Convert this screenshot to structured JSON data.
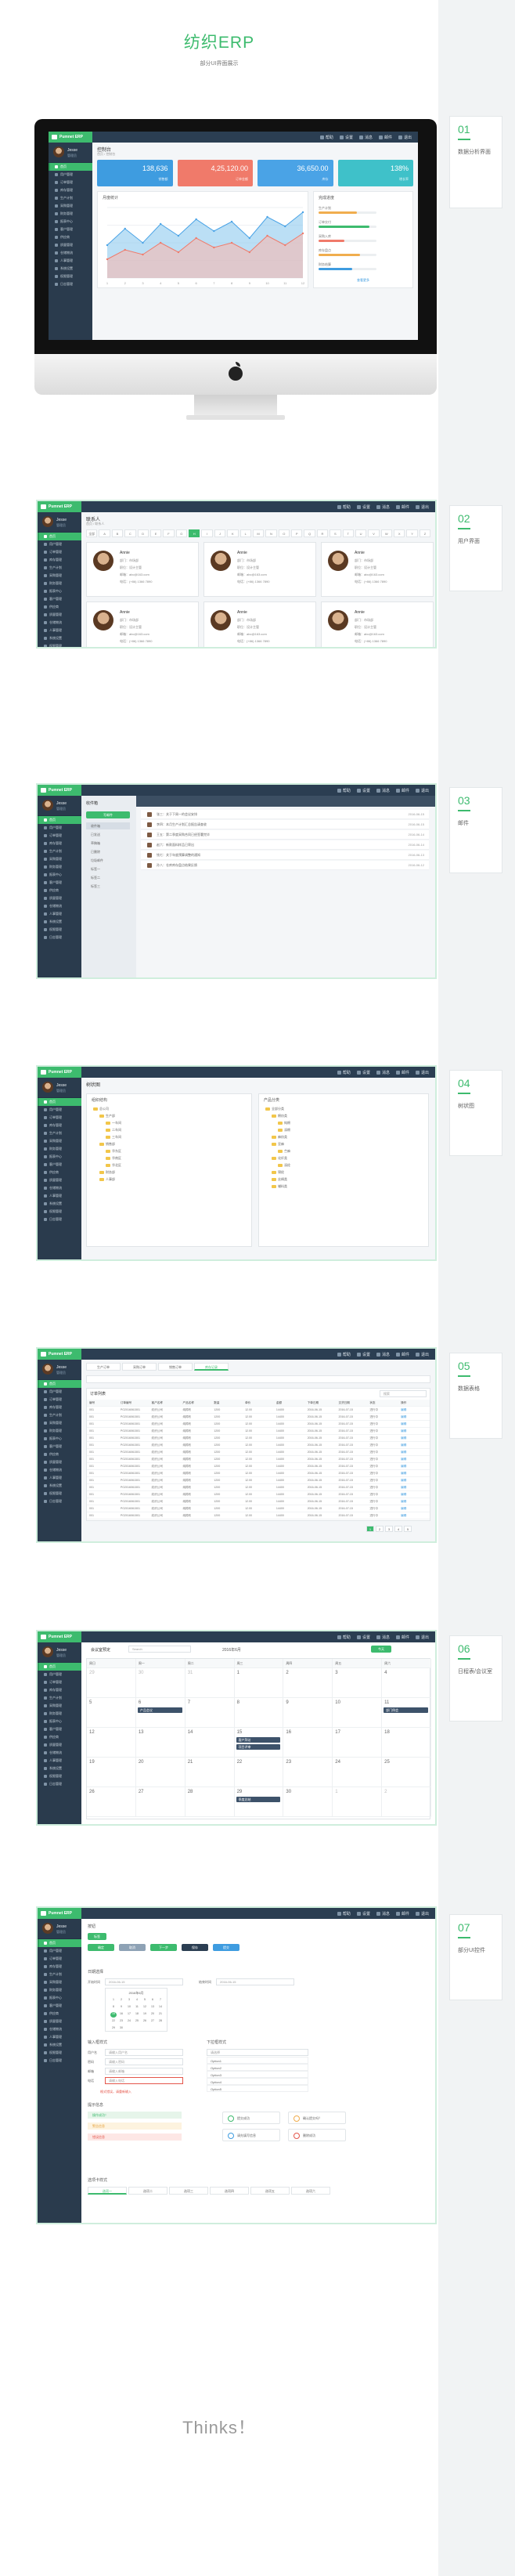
{
  "hero": {
    "title": "纺织ERP",
    "subtitle": "部分UI界面展示"
  },
  "footer": {
    "thanks": "Thinks！"
  },
  "sections": [
    {
      "num": "01",
      "label": "数据分析界面"
    },
    {
      "num": "02",
      "label": "用户界面"
    },
    {
      "num": "03",
      "label": "邮件"
    },
    {
      "num": "04",
      "label": "树状图"
    },
    {
      "num": "05",
      "label": "数据表格"
    },
    {
      "num": "06",
      "label": "日程表/会议室"
    },
    {
      "num": "07",
      "label": "部分UI控件"
    }
  ],
  "app": {
    "logo": "Pumnet ERP",
    "profile": {
      "name": "Jesse",
      "role": "管理员"
    },
    "topbar": [
      "帮助",
      "设置",
      "消息",
      "邮件",
      "退出"
    ],
    "nav": [
      "首页",
      "用户管理",
      "订单管理",
      "库存管理",
      "生产计划",
      "采购管理",
      "财务管理",
      "报表中心",
      "客户管理",
      "供应商",
      "质量管理",
      "仓储物流",
      "人事管理",
      "系统设置",
      "权限管理",
      "日志管理"
    ]
  },
  "dashboard": {
    "page_title": "控制台",
    "breadcrumb": "首页 / 控制台",
    "kpis": [
      {
        "value": "138,636",
        "label": "销售额",
        "color": "#3e9ce0"
      },
      {
        "value": "4,25,120.00",
        "label": "订单金额",
        "color": "#f07a6a"
      },
      {
        "value": "36,650.00",
        "label": "库存",
        "color": "#4aa3e6"
      },
      {
        "value": "138%",
        "label": "增长率",
        "color": "#3fc1c9"
      }
    ],
    "chart_title": "月度统计",
    "progress_title": "完成进度",
    "progress": [
      {
        "label": "生产计划",
        "value": 0.66,
        "color": "#f0ad4e"
      },
      {
        "label": "订单交付",
        "value": 0.88,
        "color": "#3dbb6e"
      },
      {
        "label": "采购入库",
        "value": 0.45,
        "color": "#f07a6a"
      },
      {
        "label": "库存盘点",
        "value": 0.72,
        "color": "#f0ad4e"
      },
      {
        "label": "财务结算",
        "value": 0.58,
        "color": "#3e9ce0"
      }
    ],
    "more": "查看更多"
  },
  "chart_data": {
    "type": "area",
    "x": [
      "1",
      "2",
      "3",
      "4",
      "5",
      "6",
      "7",
      "8",
      "9",
      "10",
      "11",
      "12"
    ],
    "series": [
      {
        "values": [
          28,
          42,
          30,
          46,
          36,
          50,
          40,
          48,
          34,
          52,
          44,
          56
        ]
      },
      {
        "values": [
          16,
          24,
          20,
          30,
          22,
          34,
          26,
          30,
          22,
          36,
          28,
          38
        ]
      }
    ],
    "ylim": [
      0,
      60
    ]
  },
  "contacts": {
    "page_title": "联系人",
    "breadcrumb": "首页 / 联系人",
    "letters": [
      "全部",
      "A",
      "B",
      "C",
      "D",
      "E",
      "F",
      "G",
      "H",
      "I",
      "J",
      "K",
      "L",
      "M",
      "N",
      "O",
      "P",
      "Q",
      "R",
      "S",
      "T",
      "U",
      "V",
      "W",
      "X",
      "Y",
      "Z"
    ],
    "cards": [
      {
        "name": "Annie",
        "dept": "部门：市场部",
        "title": "职位：设计主管",
        "email": "邮箱：abc@163.com",
        "phone": "电话：(+86) 1366 7890"
      },
      {
        "name": "Annie",
        "dept": "部门：市场部",
        "title": "职位：设计主管",
        "email": "邮箱：abc@163.com",
        "phone": "电话：(+86) 1366 7890"
      },
      {
        "name": "Annie",
        "dept": "部门：市场部",
        "title": "职位：设计主管",
        "email": "邮箱：abc@163.com",
        "phone": "电话：(+86) 1366 7890"
      },
      {
        "name": "Annie",
        "dept": "部门：市场部",
        "title": "职位：设计主管",
        "email": "邮箱：abc@163.com",
        "phone": "电话：(+86) 1366 7890"
      },
      {
        "name": "Annie",
        "dept": "部门：市场部",
        "title": "职位：设计主管",
        "email": "邮箱：abc@163.com",
        "phone": "电话：(+86) 1366 7890"
      },
      {
        "name": "Annie",
        "dept": "部门：市场部",
        "title": "职位：设计主管",
        "email": "邮箱：abc@163.com",
        "phone": "电话：(+86) 1366 7890"
      }
    ]
  },
  "mail": {
    "title": "收件箱",
    "compose": "写邮件",
    "folders": [
      "收件箱",
      "已发送",
      "草稿箱",
      "已删除",
      "垃圾邮件",
      "标签一",
      "标签二",
      "标签三"
    ],
    "rows": [
      {
        "subject": "张三：关于下周一的会议安排",
        "date": "2016-06-15"
      },
      {
        "subject": "李四：本月生产计划汇总报告请查收",
        "date": "2016-06-15"
      },
      {
        "subject": "王五：第二季度采购合同已经签署完毕",
        "date": "2016-06-14"
      },
      {
        "subject": "赵六：新款面料样品已寄出",
        "date": "2016-06-14"
      },
      {
        "subject": "钱七：关于年度预算调整的通知",
        "date": "2016-06-13"
      },
      {
        "subject": "孙八：仓库库存盘点结果反馈",
        "date": "2016-06-12"
      }
    ]
  },
  "tree": {
    "page_title": "树状图",
    "left_title": "组织结构",
    "right_title": "产品分类",
    "left_nodes": [
      "总公司",
      "生产部",
      "一车间",
      "二车间",
      "三车间",
      "销售部",
      "华东区",
      "华南区",
      "华北区",
      "财务部",
      "人事部"
    ],
    "right_nodes": [
      "全部分类",
      "棉纺类",
      "纯棉",
      "涤棉",
      "麻纺类",
      "亚麻",
      "苎麻",
      "化纤类",
      "涤纶",
      "锦纶",
      "丝绸类",
      "辅料类"
    ]
  },
  "table": {
    "tabs": [
      "生产订单",
      "采购订单",
      "销售订单",
      "库存记录"
    ],
    "title": "订单列表",
    "search_placeholder": "搜索",
    "headers": [
      "编号",
      "订单编号",
      "客户名称",
      "产品名称",
      "数量",
      "单价",
      "金额",
      "下单日期",
      "交货日期",
      "状态",
      "操作"
    ],
    "row": [
      "001",
      "PO2016061501",
      "纺织公司",
      "纯棉布",
      "1200",
      "12.00",
      "14400",
      "2016-06-15",
      "2016-07-15",
      "进行中",
      "编辑"
    ],
    "pages": [
      "1",
      "2",
      "3",
      "4",
      "5"
    ]
  },
  "calendar": {
    "title": "会议室预定",
    "search": "Search",
    "month": "2016年6月",
    "today": "今天",
    "weekdays": [
      "周日",
      "周一",
      "周二",
      "周三",
      "周四",
      "周五",
      "周六"
    ],
    "days": [
      [
        "29",
        "30",
        "31",
        "1",
        "2",
        "3",
        "4"
      ],
      [
        "5",
        "6",
        "7",
        "8",
        "9",
        "10",
        "11"
      ],
      [
        "12",
        "13",
        "14",
        "15",
        "16",
        "17",
        "18"
      ],
      [
        "19",
        "20",
        "21",
        "22",
        "23",
        "24",
        "25"
      ],
      [
        "26",
        "27",
        "28",
        "29",
        "30",
        "1",
        "2"
      ]
    ],
    "events": [
      {
        "text": "产品会议",
        "week": 1,
        "day": 1
      },
      {
        "text": "部门例会",
        "week": 1,
        "day": 6
      },
      {
        "text": "客户拜访",
        "week": 2,
        "day": 3
      },
      {
        "text": "项目评审",
        "week": 2,
        "day": 3
      },
      {
        "text": "季度总结",
        "week": 4,
        "day": 3
      }
    ]
  },
  "ui": {
    "page_title": "按钮",
    "tag": "标签",
    "buttons": [
      "确定",
      "取消",
      "下一步",
      "保存",
      "提交"
    ],
    "date_label": "日期选择",
    "date_start": "开始时间",
    "date_end": "结束时间",
    "date_placeholder": "2016-06-15",
    "cal_month": "2016年6月",
    "form_title": "输入框样式",
    "form_fields": [
      {
        "label": "用户名",
        "value": "请输入用户名"
      },
      {
        "label": "密码",
        "value": "请输入密码"
      },
      {
        "label": "邮箱",
        "value": "请输入邮箱"
      },
      {
        "label": "电话",
        "value": "请输入电话"
      }
    ],
    "form_error": "格式错误，请重新输入",
    "select_title": "下拉框样式",
    "select_value": "请选择",
    "select_options": [
      "Option1",
      "Option2",
      "Option3",
      "Option4",
      "Option5"
    ],
    "alert_title": "提示信息",
    "alerts": [
      {
        "text": "操作成功！",
        "bg": "#e6f5ea",
        "color": "#3dbb6e"
      },
      {
        "text": "警告信息",
        "bg": "#fdf3df",
        "color": "#e6a23c"
      },
      {
        "text": "错误信息",
        "bg": "#fde7e5",
        "color": "#e4564b"
      }
    ],
    "messages": [
      {
        "text": "提交成功",
        "color": "#3dbb6e"
      },
      {
        "text": "确认提交吗？",
        "color": "#f0ad4e"
      },
      {
        "text": "请先填写信息",
        "color": "#3e9ce0"
      },
      {
        "text": "删除成功",
        "color": "#e4564b"
      }
    ],
    "tabs_title": "选项卡样式",
    "tabs": [
      "选项一",
      "选项二",
      "选项三",
      "选项四",
      "选项五",
      "选项六"
    ]
  }
}
